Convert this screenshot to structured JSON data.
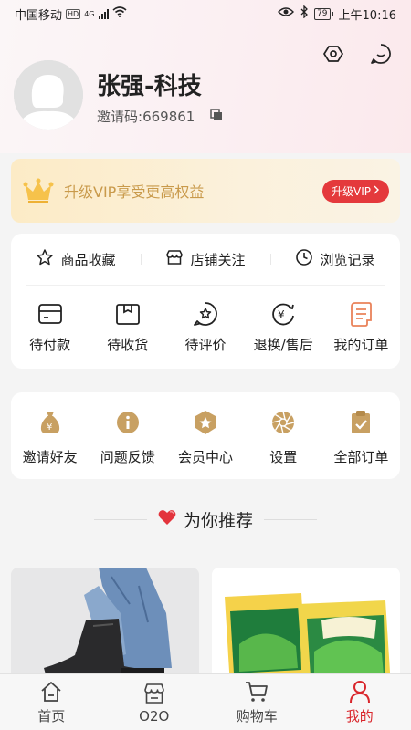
{
  "status_bar": {
    "carrier": "中国移动",
    "hd": "HD",
    "network": "4G",
    "battery": "79",
    "time": "上午10:16"
  },
  "profile": {
    "name": "张强-科技",
    "invite_label": "邀请码: ",
    "invite_code": "669861"
  },
  "vip": {
    "text": "升级VIP享受更高权益",
    "button": "升级VIP"
  },
  "quick_links": [
    {
      "label": "商品收藏",
      "icon": "star-icon"
    },
    {
      "label": "店铺关注",
      "icon": "store-icon"
    },
    {
      "label": "浏览记录",
      "icon": "clock-icon"
    }
  ],
  "orders": [
    {
      "label": "待付款",
      "icon": "wallet-icon"
    },
    {
      "label": "待收货",
      "icon": "box-icon"
    },
    {
      "label": "待评价",
      "icon": "chat-star-icon"
    },
    {
      "label": "退换/售后",
      "icon": "yen-return-icon"
    },
    {
      "label": "我的订单",
      "icon": "scroll-icon"
    }
  ],
  "services": [
    {
      "label": "邀请好友",
      "icon": "money-bag-icon"
    },
    {
      "label": "问题反馈",
      "icon": "info-icon"
    },
    {
      "label": "会员中心",
      "icon": "badge-star-icon"
    },
    {
      "label": "设置",
      "icon": "aperture-icon"
    },
    {
      "label": "全部订单",
      "icon": "clipboard-check-icon"
    }
  ],
  "recommend": {
    "title": "为你推荐"
  },
  "tabs": [
    {
      "label": "首页",
      "icon": "home-icon"
    },
    {
      "label": "O2O",
      "icon": "shop-icon"
    },
    {
      "label": "购物车",
      "icon": "cart-icon"
    },
    {
      "label": "我的",
      "icon": "user-icon",
      "active": true
    }
  ],
  "colors": {
    "accent": "#e4393c",
    "vip_gold": "#c99a4b",
    "icon_gold": "#c8a062",
    "icon_orange": "#e9825a"
  }
}
